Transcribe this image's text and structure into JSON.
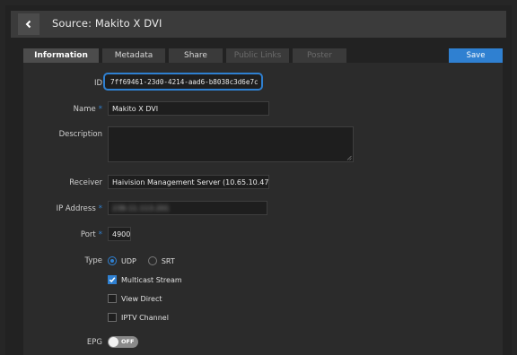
{
  "header": {
    "title": "Source: Makito X DVI"
  },
  "tabs": [
    {
      "label": "Information",
      "state": "active"
    },
    {
      "label": "Metadata",
      "state": "normal"
    },
    {
      "label": "Share",
      "state": "normal"
    },
    {
      "label": "Public Links",
      "state": "disabled"
    },
    {
      "label": "Poster",
      "state": "disabled"
    }
  ],
  "save_label": "Save",
  "form": {
    "id": {
      "label": "ID",
      "value": "7ff69461-23d0-4214-aad6-b8038c3d6e7c"
    },
    "name": {
      "label": "Name",
      "value": "Makito X DVI"
    },
    "description": {
      "label": "Description",
      "value": ""
    },
    "receiver": {
      "label": "Receiver",
      "value": "Haivision Management Server (10.65.10.47"
    },
    "ip": {
      "label": "IP Address",
      "value": "239.11.113.201"
    },
    "port": {
      "label": "Port",
      "value": "4900"
    },
    "type": {
      "label": "Type",
      "options": [
        "UDP",
        "SRT"
      ],
      "selected": "UDP"
    },
    "checkboxes": [
      {
        "label": "Multicast Stream",
        "checked": true
      },
      {
        "label": "View Direct",
        "checked": false
      },
      {
        "label": "IPTV Channel",
        "checked": false
      }
    ],
    "epg": {
      "label": "EPG",
      "state": "OFF"
    },
    "required_marker": "*"
  },
  "colors": {
    "accent": "#2f80d1",
    "background": "#262626",
    "header": "#3b3b3b"
  }
}
